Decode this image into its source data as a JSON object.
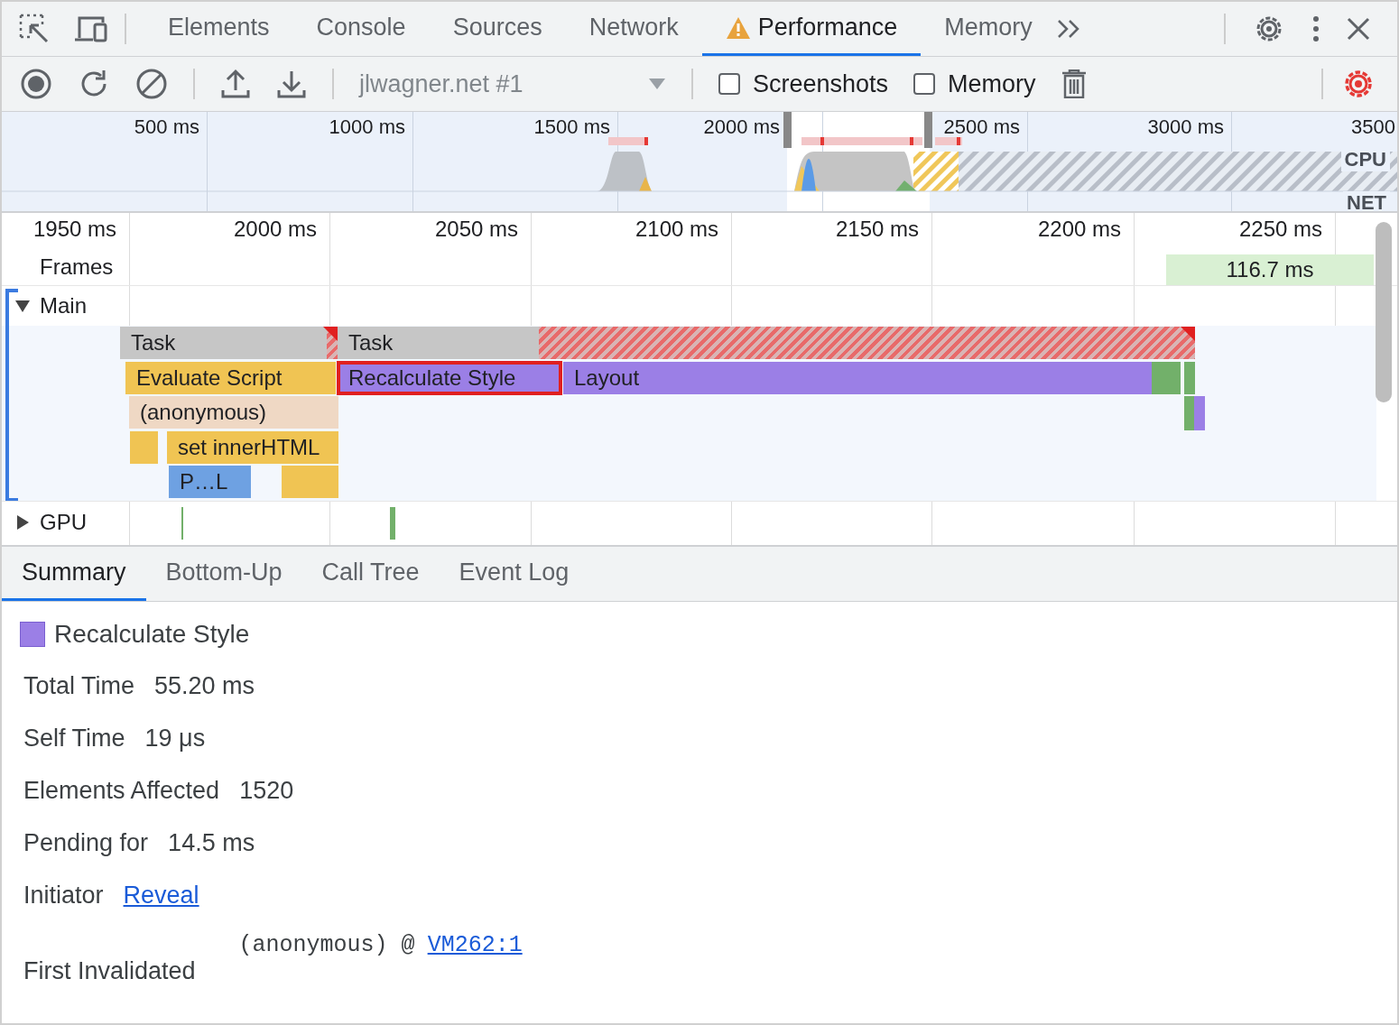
{
  "panel_tabs": [
    {
      "label": "Elements",
      "selected": false,
      "warning": false
    },
    {
      "label": "Console",
      "selected": false,
      "warning": false
    },
    {
      "label": "Sources",
      "selected": false,
      "warning": false
    },
    {
      "label": "Network",
      "selected": false,
      "warning": false
    },
    {
      "label": "Performance",
      "selected": true,
      "warning": true
    },
    {
      "label": "Memory",
      "selected": false,
      "warning": false
    }
  ],
  "toolbar": {
    "target": "jlwagner.net #1",
    "checkboxes": [
      {
        "label": "Screenshots",
        "checked": false
      },
      {
        "label": "Memory",
        "checked": false
      }
    ]
  },
  "overview": {
    "ticks": [
      "500 ms",
      "1000 ms",
      "1500 ms",
      "2000 ms",
      "2500 ms",
      "3000 ms",
      "3500"
    ],
    "lanes": [
      "CPU",
      "NET"
    ]
  },
  "timeline": {
    "ticks": [
      "1950 ms",
      "2000 ms",
      "2050 ms",
      "2100 ms",
      "2150 ms",
      "2200 ms",
      "2250 ms"
    ],
    "frames": {
      "label": "Frames",
      "frame": "116.7 ms"
    },
    "main": {
      "label": "Main",
      "expanded": true,
      "entries": [
        {
          "kind": "long-task",
          "label": "Task",
          "selected": false
        },
        {
          "kind": "long-task",
          "label": "Task",
          "selected": false
        },
        {
          "kind": "script",
          "label": "Evaluate Script",
          "selected": false
        },
        {
          "kind": "rendering",
          "label": "Recalculate Style",
          "selected": true
        },
        {
          "kind": "rendering",
          "label": "Layout",
          "selected": false
        },
        {
          "kind": "painting",
          "selected": false
        },
        {
          "kind": "painting",
          "selected": false
        },
        {
          "kind": "function",
          "label": "(anonymous)",
          "selected": false
        },
        {
          "kind": "painting",
          "selected": false
        },
        {
          "kind": "rendering",
          "selected": false
        },
        {
          "kind": "script",
          "selected": false
        },
        {
          "kind": "script",
          "label": "set innerHTML",
          "selected": false
        },
        {
          "kind": "parse",
          "label": "P…L",
          "selected": false
        },
        {
          "kind": "script",
          "selected": false
        }
      ]
    },
    "gpu": {
      "label": "GPU",
      "expanded": false
    }
  },
  "details": {
    "tabs": [
      {
        "label": "Summary",
        "selected": true
      },
      {
        "label": "Bottom-Up",
        "selected": false
      },
      {
        "label": "Call Tree",
        "selected": false
      },
      {
        "label": "Event Log",
        "selected": false
      }
    ],
    "title": "Recalculate Style",
    "rows": [
      {
        "label": "Total Time",
        "value": "55.20 ms"
      },
      {
        "label": "Self Time",
        "value": "19 μs"
      },
      {
        "label": "Elements Affected",
        "value": "1520"
      },
      {
        "label": "Pending for",
        "value": "14.5 ms"
      },
      {
        "label": "Initiator",
        "link": "Reveal"
      }
    ],
    "first_invalidated": {
      "label": "First Invalidated",
      "source": "(anonymous) @",
      "link": "VM262:1"
    }
  }
}
